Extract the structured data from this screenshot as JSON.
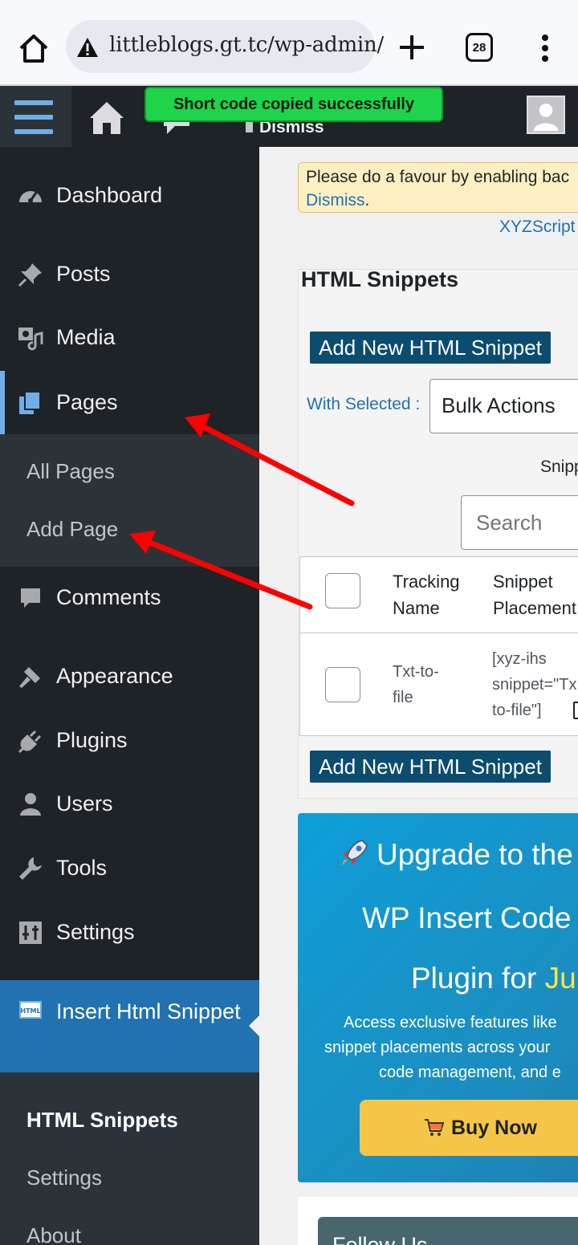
{
  "browser": {
    "url": "littleblogs.gt.tc/wp-admin/",
    "tab_count": "28"
  },
  "admin_bar": {
    "toast": "Short code copied successfully",
    "dismiss": "Dismiss"
  },
  "sidebar": {
    "items": [
      {
        "label": "Dashboard",
        "icon": "dashboard-icon"
      },
      {
        "label": "Posts",
        "icon": "pin-icon"
      },
      {
        "label": "Media",
        "icon": "media-icon"
      },
      {
        "label": "Pages",
        "icon": "pages-icon"
      },
      {
        "label": "Comments",
        "icon": "comment-icon"
      },
      {
        "label": "Appearance",
        "icon": "brush-icon"
      },
      {
        "label": "Plugins",
        "icon": "plug-icon"
      },
      {
        "label": "Users",
        "icon": "user-icon"
      },
      {
        "label": "Tools",
        "icon": "wrench-icon"
      },
      {
        "label": "Settings",
        "icon": "sliders-icon"
      }
    ],
    "pages_submenu": [
      "All Pages",
      "Add Page"
    ],
    "ihs": {
      "label": "Insert Html Snippet",
      "submenu": [
        "HTML Snippets",
        "Settings",
        "About"
      ]
    }
  },
  "main": {
    "notice_text": "Please do a favour by enabling bac",
    "notice_link": "Dismiss",
    "xyz_link": "XYZScript",
    "title": "HTML Snippets",
    "add_button": "Add New HTML Snippet",
    "with_selected": "With Selected :",
    "bulk_actions": "Bulk Actions",
    "snipp_label": "Snipp",
    "search_placeholder": "Search",
    "table": {
      "col1": [
        "Tracking",
        "Name"
      ],
      "col2": [
        "Snippet",
        "Placement"
      ],
      "row": {
        "name": [
          "Txt-to-",
          "file"
        ],
        "placement": [
          "[xyz-ihs",
          "snippet=\"Tx",
          "to-file\"]"
        ]
      }
    }
  },
  "upgrade": {
    "title": "Upgrade to the",
    "line2": "WP Insert Code S",
    "line3_prefix": "Plugin for ",
    "line3_highlight": "Ju",
    "desc": [
      "Access exclusive features like",
      "snippet placements across your",
      "code management, and e"
    ],
    "buy": "Buy Now",
    "follow": "Follow Us"
  },
  "colors": {
    "accent": "#72aee6",
    "sidebar_bg": "#1d2327",
    "active_menu": "#2271b1",
    "toast": "#1fd34a",
    "annotation_arrow": "#ff0000"
  }
}
